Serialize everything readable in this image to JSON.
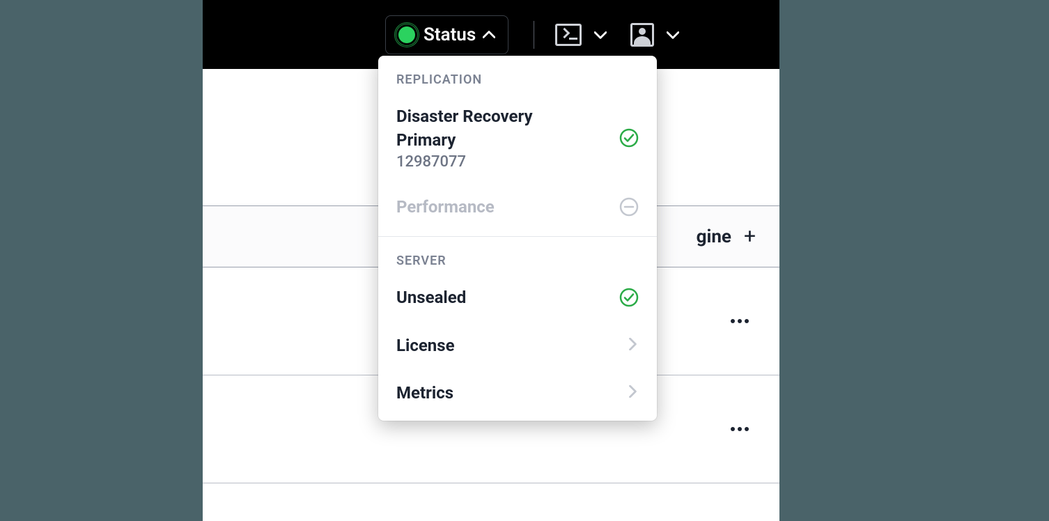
{
  "header": {
    "status_label": "Status"
  },
  "dropdown": {
    "replication": {
      "section_label": "REPLICATION",
      "dr": {
        "title_line1": "Disaster Recovery",
        "title_line2": "Primary",
        "id": "12987077"
      },
      "performance": {
        "title": "Performance"
      }
    },
    "server": {
      "section_label": "SERVER",
      "unsealed": {
        "title": "Unsealed"
      },
      "license": {
        "title": "License"
      },
      "metrics": {
        "title": "Metrics"
      }
    }
  },
  "main": {
    "banner_fragment": "gine"
  }
}
